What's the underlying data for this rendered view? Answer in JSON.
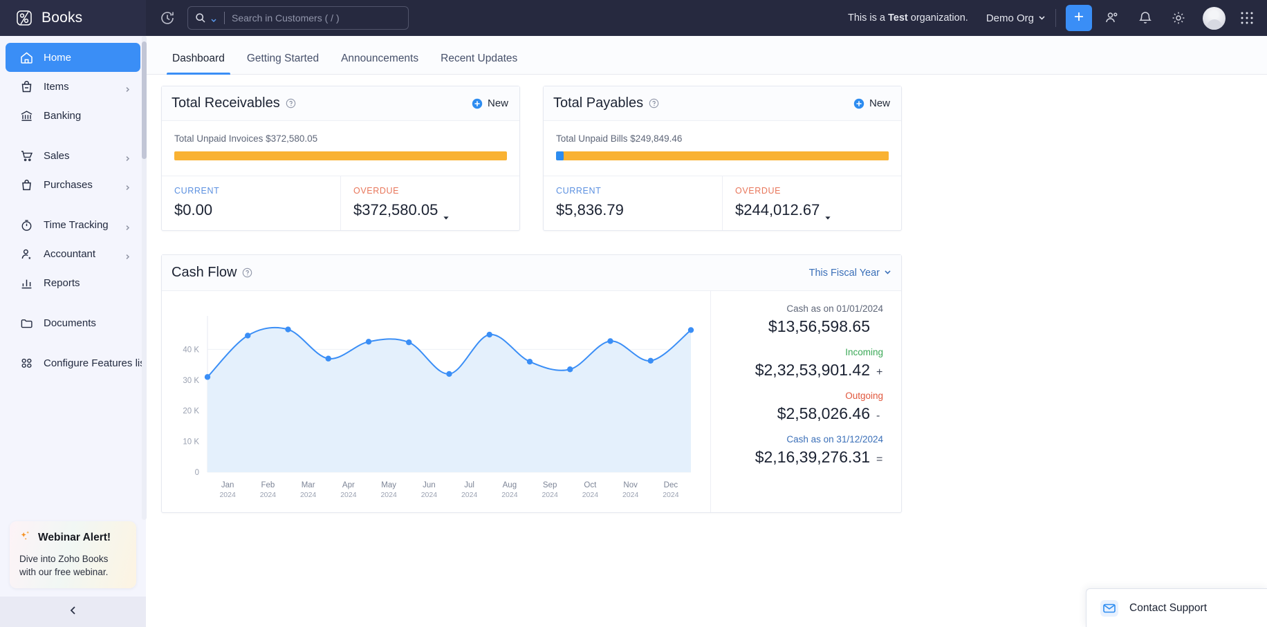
{
  "app": {
    "brand": "Books",
    "logo_icon": "books-logo-icon"
  },
  "topbar": {
    "history_icon": "history-clock-icon",
    "search": {
      "icon": "search-icon",
      "caret_icon": "chevron-down-icon",
      "placeholder": "Search in Customers ( / )",
      "value": ""
    },
    "test_org_prefix": "This is a ",
    "test_org_bold": "Test",
    "test_org_suffix": " organization.",
    "org_name": "Demo Org",
    "org_caret_icon": "chevron-down-icon",
    "add_button_icon": "plus-icon",
    "contacts_icon": "people-icon",
    "notifications_icon": "bell-icon",
    "settings_icon": "gear-icon",
    "avatar_icon": "user-avatar",
    "apps_icon": "grid-dots-icon"
  },
  "sidebar": {
    "items": [
      {
        "label": "Home",
        "icon": "home-icon",
        "active": true,
        "chevron": false
      },
      {
        "label": "Items",
        "icon": "items-bag-icon",
        "active": false,
        "chevron": true
      },
      {
        "label": "Banking",
        "icon": "bank-icon",
        "active": false,
        "chevron": false
      },
      {
        "label": "Sales",
        "icon": "cart-icon",
        "active": false,
        "chevron": true
      },
      {
        "label": "Purchases",
        "icon": "purchase-bag-icon",
        "active": false,
        "chevron": true
      },
      {
        "label": "Time Tracking",
        "icon": "stopwatch-icon",
        "active": false,
        "chevron": true
      },
      {
        "label": "Accountant",
        "icon": "accountant-icon",
        "active": false,
        "chevron": true
      },
      {
        "label": "Reports",
        "icon": "bar-chart-icon",
        "active": false,
        "chevron": false
      },
      {
        "label": "Documents",
        "icon": "folder-icon",
        "active": false,
        "chevron": false
      },
      {
        "label": "Configure Features list",
        "icon": "configure-icon",
        "active": false,
        "chevron": false
      }
    ],
    "webinar": {
      "sparkle_icon": "sparkle-icon",
      "title": "Webinar Alert!",
      "description": "Dive into Zoho Books with our free webinar."
    },
    "collapse_icon": "chevron-left-icon"
  },
  "tabs": [
    {
      "label": "Dashboard",
      "active": true
    },
    {
      "label": "Getting Started",
      "active": false
    },
    {
      "label": "Announcements",
      "active": false
    },
    {
      "label": "Recent Updates",
      "active": false
    }
  ],
  "receivables": {
    "title": "Total Receivables",
    "help_icon": "help-circle-icon",
    "new_label": "New",
    "new_icon": "plus-circle-icon",
    "unpaid_label": "Total Unpaid Invoices $372,580.05",
    "bar": {
      "blue_pct": 0,
      "amber_pct": 100
    },
    "current_label": "CURRENT",
    "current_value": "$0.00",
    "overdue_label": "OVERDUE",
    "overdue_value": "$372,580.05",
    "caret_icon": "caret-down-icon"
  },
  "payables": {
    "title": "Total Payables",
    "help_icon": "help-circle-icon",
    "new_label": "New",
    "new_icon": "plus-circle-icon",
    "unpaid_label": "Total Unpaid Bills $249,849.46",
    "bar": {
      "blue_pct": 2.3,
      "amber_pct": 97.7
    },
    "current_label": "CURRENT",
    "current_value": "$5,836.79",
    "overdue_label": "OVERDUE",
    "overdue_value": "$244,012.67",
    "caret_icon": "caret-down-icon"
  },
  "cashflow": {
    "title": "Cash Flow",
    "help_icon": "help-circle-icon",
    "period": "This Fiscal Year",
    "period_caret_icon": "chevron-down-icon",
    "summary": [
      {
        "label": "Cash as on 01/01/2024",
        "value": "$13,56,598.65",
        "op": "",
        "tone": "muted"
      },
      {
        "label": "Incoming",
        "value": "$2,32,53,901.42",
        "op": "+",
        "tone": "green"
      },
      {
        "label": "Outgoing",
        "value": "$2,58,026.46",
        "op": "-",
        "tone": "red"
      },
      {
        "label": "Cash as on 31/12/2024",
        "value": "$2,16,39,276.31",
        "op": "=",
        "tone": "blue"
      }
    ]
  },
  "chart_data": {
    "type": "area",
    "title": "Cash Flow",
    "xlabel": "",
    "ylabel": "",
    "categories": [
      "Jan",
      "Feb",
      "Mar",
      "Apr",
      "May",
      "Jun",
      "Jul",
      "Aug",
      "Sep",
      "Oct",
      "Nov",
      "Dec"
    ],
    "category_year": "2024",
    "values": [
      31000,
      44500,
      46500,
      37000,
      42500,
      42300,
      32000,
      44800,
      36000,
      33500,
      42700,
      36300,
      46300
    ],
    "series": [
      {
        "name": "Cash Flow",
        "values": [
          31000,
          44500,
          46500,
          37000,
          42500,
          42300,
          32000,
          44800,
          36000,
          33500,
          42700,
          36300,
          46300
        ]
      }
    ],
    "ytick_labels": [
      "0",
      "10 K",
      "20 K",
      "30 K",
      "40 K"
    ],
    "ytick_values": [
      0,
      10000,
      20000,
      30000,
      40000
    ],
    "ylim": [
      0,
      50000
    ],
    "grid": true,
    "legend": "none",
    "line_color": "#3a8ef6",
    "fill_color": "#e4f0fc"
  },
  "support": {
    "icon": "chat-support-icon",
    "label": "Contact Support"
  }
}
